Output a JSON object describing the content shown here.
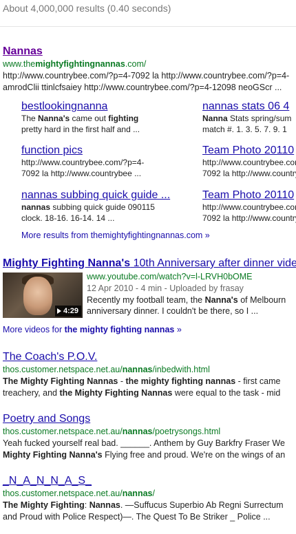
{
  "stats": "About 4,000,000 results (0.40 seconds)",
  "r1": {
    "title": "Nannas",
    "url_pre": "www.the",
    "url_bold": "mightyfightingnannas",
    "url_post": ".com/",
    "line1": "http://www.countrybee.com/?p=4-7092 la http://www.countrybee.com/?p=4-",
    "line2": "amrodClii ttinlcfsaiey http://www.countrybee.com/?p=4-12098 neoGScr ..."
  },
  "sitelinks": [
    {
      "title": "bestlookingnanna",
      "l1": [
        "The ",
        "Nanna's",
        " came out ",
        "fighting"
      ],
      "l2": "pretty hard in the first half and ..."
    },
    {
      "title": "nannas stats 06 4",
      "l1": [
        "",
        "Nanna",
        " Stats spring/sum",
        ""
      ],
      "l2": "match #. 1. 3. 5. 7. 9. 1"
    },
    {
      "title": "function pics",
      "l1": [
        "http://www.countrybee.com/?p=4-",
        "",
        "",
        ""
      ],
      "l2": "7092 la http://www.countrybee ..."
    },
    {
      "title": "Team Photo 20110",
      "l1": [
        "http://www.countrybee.com",
        "",
        "",
        ""
      ],
      "l2": "7092 la http://www.countrybe"
    },
    {
      "title": "nannas subbing quick guide ...",
      "l1": [
        "",
        "nannas",
        " subbing quick guide 090115",
        ""
      ],
      "l2": "clock. 18-16. 16-14. 14 ..."
    },
    {
      "title": "Team Photo 20110",
      "l1": [
        "http://www.countrybee.com",
        "",
        "",
        ""
      ],
      "l2": "7092 la http://www.countrybe"
    }
  ],
  "more_results": "More results from themightyfightingnannas.com »",
  "video": {
    "title_bold": "Mighty Fighting Nanna's",
    "title_rest": " 10th Anniversary after dinner vide",
    "url": "www.youtube.com/watch?v=l-LRVH0bOME",
    "meta": "12 Apr 2010 - 4 min - Uploaded by frasay",
    "snip1_pre": "Recently my football team, the ",
    "snip1_bold": "Nanna's",
    "snip1_post": " of Melbourn",
    "snip2": "anniversary dinner. I couldn't be there, so I ...",
    "duration": "4:29"
  },
  "more_videos": {
    "pre": "More videos for ",
    "bold": "the mighty fighting nannas",
    "post": " »"
  },
  "r2": {
    "title": "The Coach's P.O.V.",
    "url_pre": "thos.customer.netspace.net.au/",
    "url_bold": "nannas",
    "url_post": "/inbedwith.html",
    "l1": [
      "The Mighty Fighting Nannas",
      " - ",
      "the mighty fighting nannas",
      " - first came"
    ],
    "l2": [
      "treachery, and ",
      "the Mighty Fighting Nannas",
      " were equal to the task - mid"
    ]
  },
  "r3": {
    "title": "Poetry and Songs",
    "url_pre": "thos.customer.netspace.net.au/",
    "url_bold": "nannas",
    "url_post": "/poetrysongs.html",
    "l1": "Yeah fucked yourself real bad. ______. Anthem by Guy Barkfry Fraser We",
    "l2": [
      "Mighty Fighting Nanna's",
      " Flying free and proud. We're on the wings of an"
    ]
  },
  "r4": {
    "title": "_N_A_N_N_A_S_",
    "url_pre": "thos.customer.netspace.net.au/",
    "url_bold": "nannas",
    "url_post": "/",
    "l1": [
      "The Mighty Fighting",
      ": ",
      "Nannas",
      ". —Suffucus Superbio Ab Regni Surrectum"
    ],
    "l2": "and Proud with Police Respect)—. The Quest To Be Striker _ Police ..."
  },
  "colors": {
    "link": "#1a0dab",
    "visited": "#660099",
    "url_green": "#0a7a23"
  }
}
